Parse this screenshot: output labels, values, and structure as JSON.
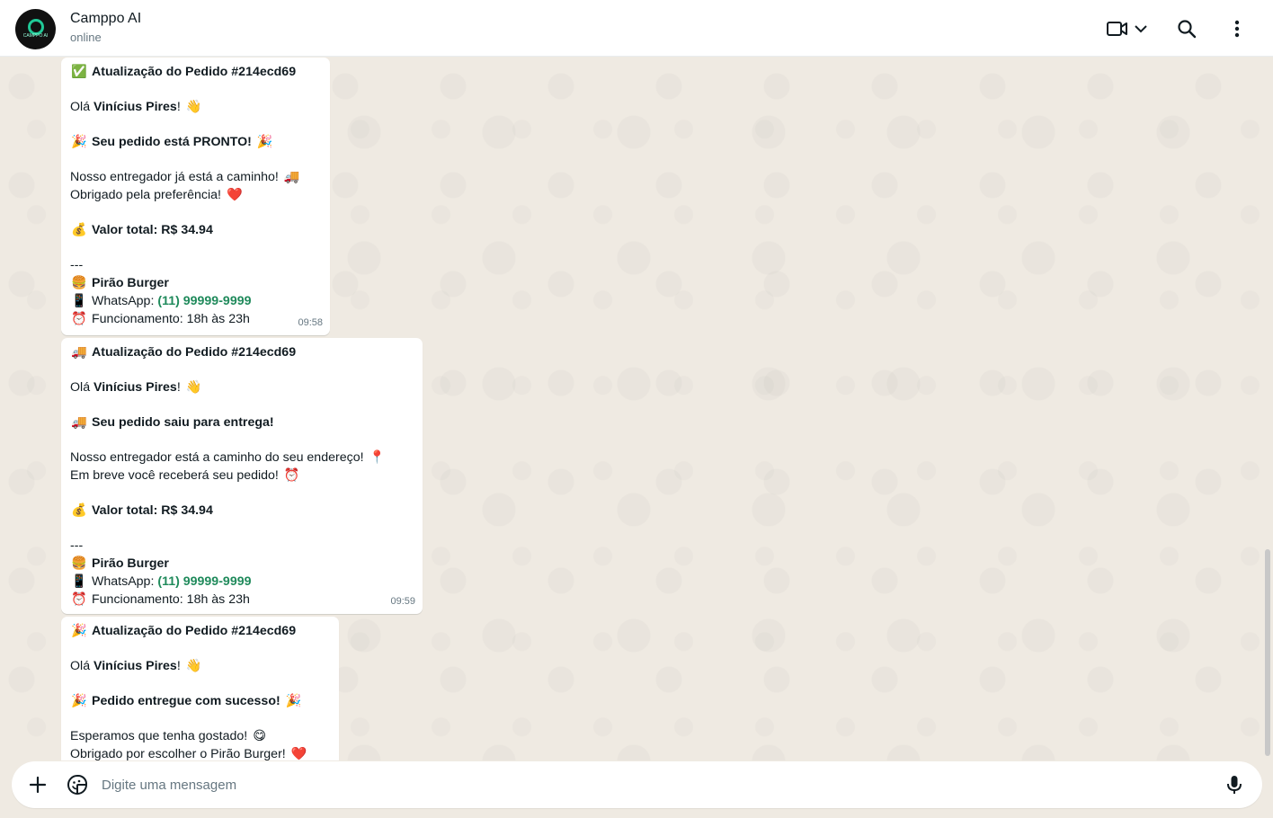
{
  "header": {
    "contact_name": "Camppo AI",
    "status": "online",
    "avatar_text": "CAMPPO AI"
  },
  "messages": [
    {
      "title_emoji": "✅",
      "title": "Atualização do Pedido #214ecd69",
      "greeting_prefix": "Olá ",
      "customer": "Vinícius Pires",
      "greeting_suffix": "!",
      "greeting_emoji": "👋",
      "headline_emoji": "🎉",
      "headline": "Seu pedido está PRONTO!",
      "headline_emoji_after": "🎉",
      "body_line1": "Nosso entregador já está a caminho!",
      "body_line1_emoji": "🚚",
      "body_line2": "Obrigado pela preferência!",
      "body_line2_emoji": "❤️",
      "total_emoji": "💰",
      "total": "Valor total: R$ 34.94",
      "separator": "---",
      "store_emoji": "🍔",
      "store": "Pirão Burger",
      "whatsapp_emoji": "📱",
      "whatsapp_label": "WhatsApp: ",
      "whatsapp_number": "(11) 99999-9999",
      "hours_emoji": "⏰",
      "hours": "Funcionamento: 18h às 23h",
      "time": "09:58"
    },
    {
      "title_emoji": "🚚",
      "title": "Atualização do Pedido #214ecd69",
      "greeting_prefix": "Olá ",
      "customer": "Vinícius Pires",
      "greeting_suffix": "!",
      "greeting_emoji": "👋",
      "headline_emoji": "🚚",
      "headline": "Seu pedido saiu para entrega!",
      "headline_emoji_after": "",
      "body_line1": "Nosso entregador está a caminho do seu endereço!",
      "body_line1_emoji": "📍",
      "body_line2": "Em breve você receberá seu pedido!",
      "body_line2_emoji": "⏰",
      "total_emoji": "💰",
      "total": "Valor total: R$ 34.94",
      "separator": "---",
      "store_emoji": "🍔",
      "store": "Pirão Burger",
      "whatsapp_emoji": "📱",
      "whatsapp_label": "WhatsApp: ",
      "whatsapp_number": "(11) 99999-9999",
      "hours_emoji": "⏰",
      "hours": "Funcionamento: 18h às 23h",
      "time": "09:59"
    },
    {
      "title_emoji": "🎉",
      "title": "Atualização do Pedido #214ecd69",
      "greeting_prefix": "Olá ",
      "customer": "Vinícius Pires",
      "greeting_suffix": "!",
      "greeting_emoji": "👋",
      "headline_emoji": "🎉",
      "headline": "Pedido entregue com sucesso!",
      "headline_emoji_after": "🎉",
      "body_line1": "Esperamos que tenha gostado!",
      "body_line1_emoji": "😋",
      "body_line2": "Obrigado por escolher o Pirão Burger!",
      "body_line2_emoji": "❤️"
    }
  ],
  "composer": {
    "placeholder": "Digite uma mensagem"
  },
  "icons": {
    "video": "video-call-icon",
    "dropdown": "chevron-down-icon",
    "search": "search-icon",
    "menu": "more-options-icon",
    "attach": "plus-icon",
    "sticker": "sticker-icon",
    "mic": "microphone-icon"
  },
  "colors": {
    "chat_background": "#efeae2",
    "bubble": "#ffffff",
    "phone_link": "#1f8a5b"
  }
}
